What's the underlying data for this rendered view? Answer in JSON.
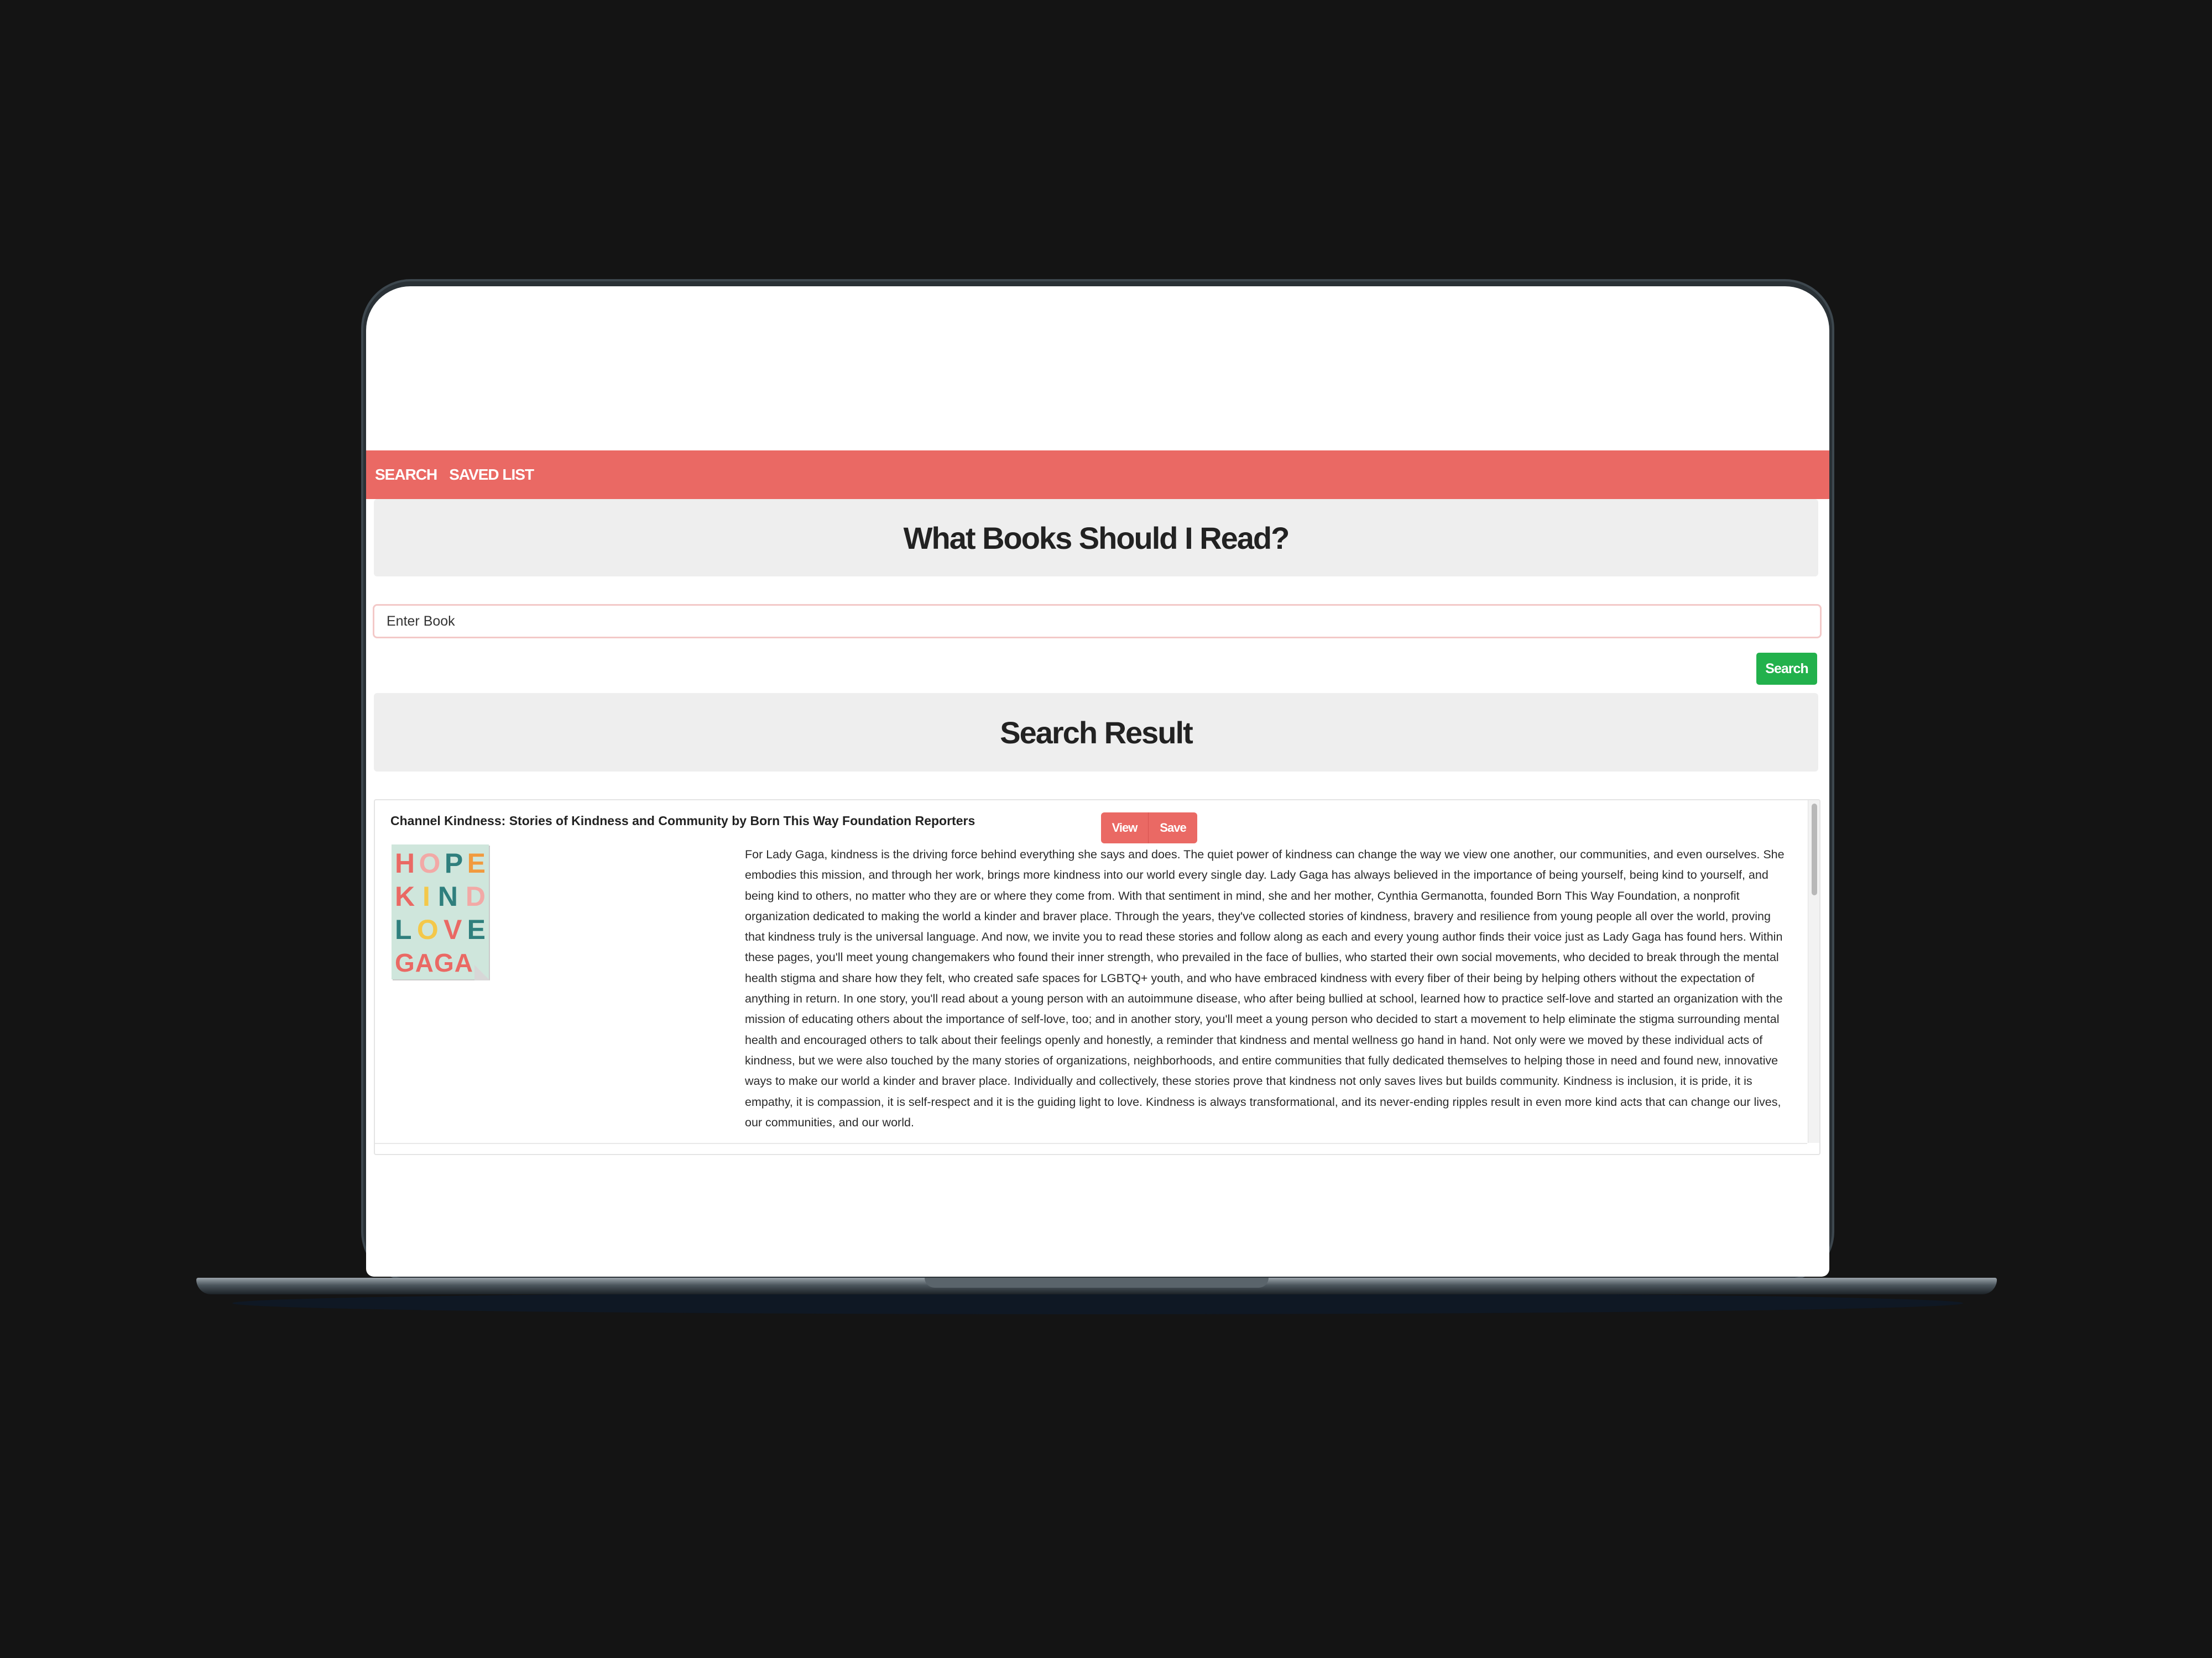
{
  "nav": {
    "search_label": "SEARCH",
    "saved_list_label": "SAVED LIST"
  },
  "heading": {
    "title": "What Books Should I Read?"
  },
  "search": {
    "placeholder": "Enter Book",
    "button_label": "Search"
  },
  "results": {
    "title": "Search Result",
    "items": [
      {
        "title": "Channel Kindness: Stories of Kindness and Community by Born This Way Foundation Reporters",
        "view_label": "View",
        "save_label": "Save",
        "cover_text": {
          "row1": [
            "H",
            "O",
            "P",
            "E"
          ],
          "row2": [
            "K",
            "I",
            "N",
            "D"
          ],
          "row3": [
            "L",
            "O",
            "V",
            "E"
          ],
          "row4": "GAGA"
        },
        "cover_colors": {
          "background": "#cfe6dc",
          "teal": "#2f7f7d",
          "coral": "#ea6964",
          "orange": "#f19a3e",
          "pink": "#f2a9a6",
          "yellow": "#f4c84a"
        },
        "description": "For Lady Gaga, kindness is the driving force behind everything she says and does. The quiet power of kindness can change the way we view one another, our communities, and even ourselves. She embodies this mission, and through her work, brings more kindness into our world every single day. Lady Gaga has always believed in the importance of being yourself, being kind to yourself, and being kind to others, no matter who they are or where they come from. With that sentiment in mind, she and her mother, Cynthia Germanotta, founded Born This Way Foundation, a nonprofit organization dedicated to making the world a kinder and braver place. Through the years, they've collected stories of kindness, bravery and resilience from young people all over the world, proving that kindness truly is the universal language. And now, we invite you to read these stories and follow along as each and every young author finds their voice just as Lady Gaga has found hers. Within these pages, you'll meet young changemakers who found their inner strength, who prevailed in the face of bullies, who started their own social movements, who decided to break through the mental health stigma and share how they felt, who created safe spaces for LGBTQ+ youth, and who have embraced kindness with every fiber of their being by helping others without the expectation of anything in return. In one story, you'll read about a young person with an autoimmune disease, who after being bullied at school, learned how to practice self-love and started an organization with the mission of educating others about the importance of self-love, too; and in another story, you'll meet a young person who decided to start a movement to help eliminate the stigma surrounding mental health and encouraged others to talk about their feelings openly and honestly, a reminder that kindness and mental wellness go hand in hand. Not only were we moved by these individual acts of kindness, but we were also touched by the many stories of organizations, neighborhoods, and entire communities that fully dedicated themselves to helping those in need and found new, innovative ways to make our world a kinder and braver place. Individually and collectively, these stories prove that kindness not only saves lives but builds community. Kindness is inclusion, it is pride, it is empathy, it is compassion, it is self-respect and it is the guiding light to love. Kindness is always transformational, and its never-ending ripples result in even more kind acts that can change our lives, our communities, and our world."
      }
    ]
  },
  "colors": {
    "navbar": "#ea6964",
    "search_button": "#22b14c",
    "panel": "#eeeeee",
    "device_background": "#141414"
  }
}
